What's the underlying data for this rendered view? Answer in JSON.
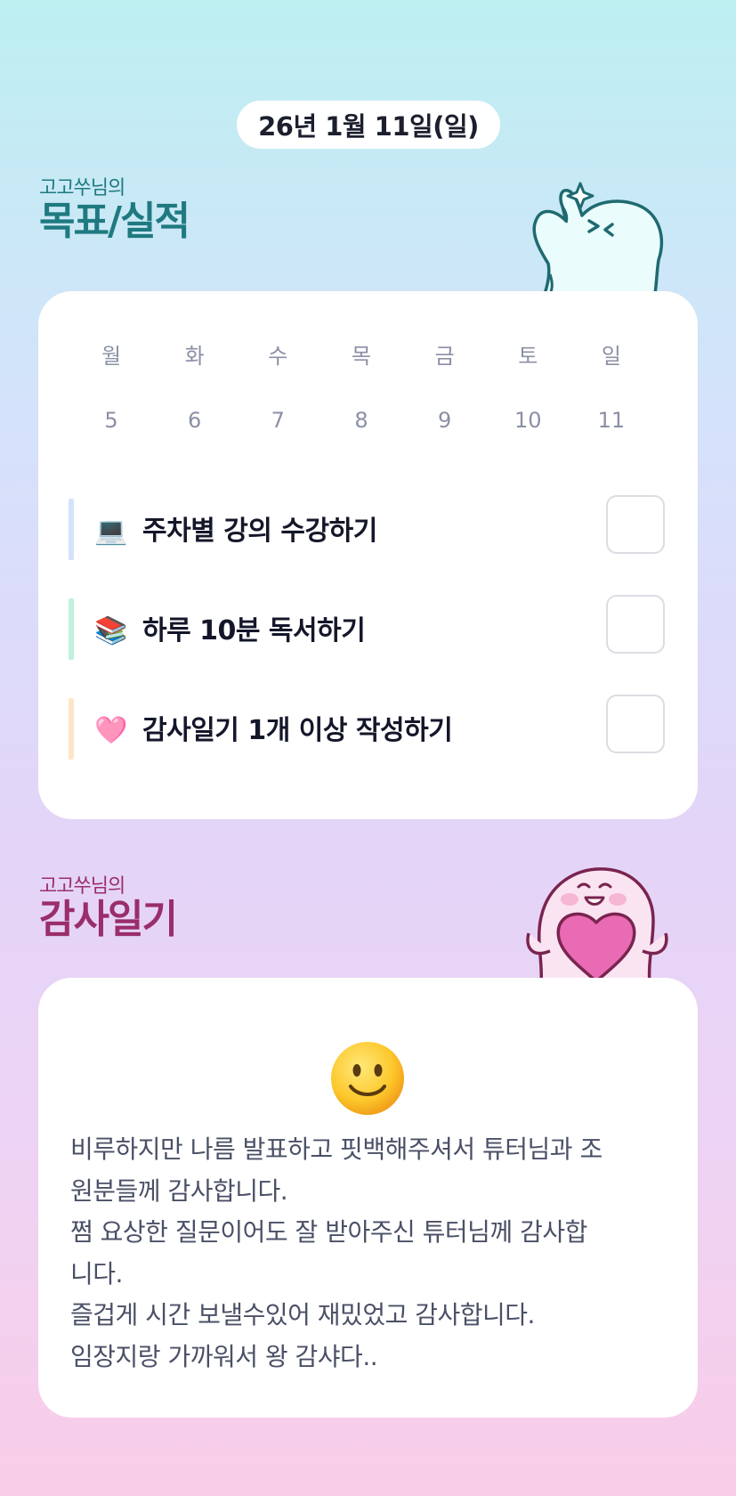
{
  "header": {
    "date": "26년 1월 11일(일)"
  },
  "goals_section": {
    "subtitle": "고고쑤님의",
    "title": "목표/실적",
    "weekdays": [
      "월",
      "화",
      "수",
      "목",
      "금",
      "토",
      "일"
    ],
    "dates": [
      "5",
      "6",
      "7",
      "8",
      "9",
      "10",
      "11"
    ],
    "goals": [
      {
        "icon": "laptop-icon",
        "emoji": "💻",
        "label": "주차별 강의 수강하기",
        "color": "#d4e3fb",
        "checked": false
      },
      {
        "icon": "books-icon",
        "emoji": "📚",
        "label": "하루 10분 독서하기",
        "color": "#bff1dd",
        "checked": false
      },
      {
        "icon": "heart-icon",
        "emoji": "🩷",
        "label": "감사일기 1개 이상 작성하기",
        "color": "#fde6c6",
        "checked": false
      }
    ]
  },
  "diary_section": {
    "subtitle": "고고쑤님의",
    "title": "감사일기",
    "mood_icon": "slightly-smiling-face-icon",
    "lines": [
      "비루하지만 나름 발표하고 핏백해주셔서 튜터님과 조",
      "원분들께 감사합니다.",
      "쩜 요상한 질문이어도 잘 받아주신 튜터님께 감사합",
      "니다.",
      "즐겁게 시간 보낼수있어 재밌었고 감사합니다.",
      "임장지랑 가까워서 왕 감샤다.."
    ]
  },
  "colors": {
    "goals_title": "#1f7a80",
    "diary_title": "#9a2e6a",
    "mascot_top": "#e8fbfb",
    "mascot_bottom": "#fbe3f1",
    "heart": "#e86bb3"
  }
}
